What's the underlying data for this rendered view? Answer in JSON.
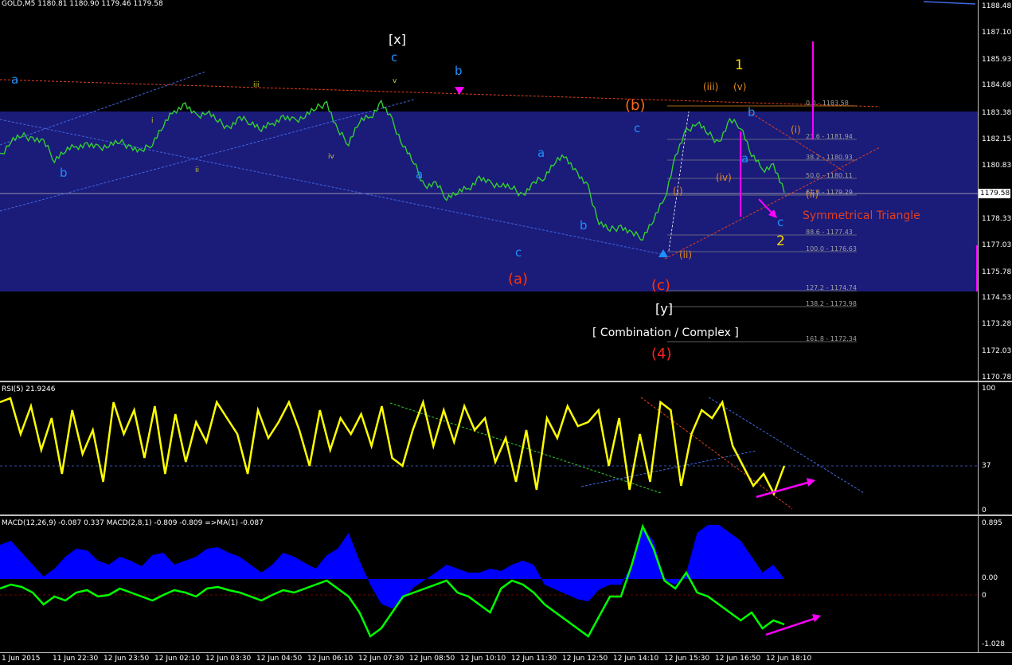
{
  "header": {
    "main": "GOLD,M5  1180.81 1180.90 1179.46 1179.58",
    "rsi": "RSI(5) 21.9246",
    "macd": "MACD(12,26,9) -0.087 0.337  MACD(2,8,1) -0.809 -0.809  =>MA(1) -0.087"
  },
  "price_axis": [
    "1188.48",
    "1187.10",
    "1185.93",
    "1184.68",
    "1183.38",
    "1182.15",
    "1180.83",
    "1179.58",
    "1178.33",
    "1177.03",
    "1175.78",
    "1174.53",
    "1173.28",
    "1172.03",
    "1170.78"
  ],
  "current_price": "1179.58",
  "rsi_axis": [
    "100",
    "37",
    "0"
  ],
  "macd_axis": [
    "0.895",
    "0.00",
    "0",
    "-1.028"
  ],
  "time_axis": [
    "1 Jun 2015",
    "11 Jun 22:30",
    "12 Jun 23:50",
    "12 Jun 02:10",
    "12 Jun 03:30",
    "12 Jun 04:50",
    "12 Jun 06:10",
    "12 Jun 07:30",
    "12 Jun 08:50",
    "12 Jun 10:10",
    "12 Jun 11:30",
    "12 Jun 12:50",
    "12 Jun 14:10",
    "12 Jun 15:30",
    "12 Jun 16:50",
    "12 Jun 18:10"
  ],
  "fib_levels": [
    "0.0 - 1183.58",
    "23.6 - 1181.94",
    "38.2 - 1180.93",
    "50.0 - 1180.11",
    "61.8 - 1179.29",
    "88.6 - 1177.43",
    "100.0 - 1176.63",
    "127.2 - 1174.74",
    "138.2 - 1173.98",
    "161.8 - 1172.34"
  ],
  "wave_labels": {
    "x": "[x]",
    "y": "[y]",
    "combo": "[ Combination / Complex ]",
    "four": "(4)",
    "a_paren": "(a)",
    "b_paren": "(b)",
    "c_paren": "(c)",
    "one": "1",
    "two": "2",
    "triangle": "Symmetrical Triangle",
    "iii_paren": "(iii)",
    "v_paren": "(v)",
    "iv_paren": "(iv)",
    "i_paren": "(i)",
    "ii_paren": "(ii)",
    "ii_paren2": "(ii)",
    "i_paren2": "(i)",
    "a1": "a",
    "b1": "b",
    "c1": "c",
    "a2": "a",
    "b2": "b",
    "c2": "c",
    "a3": "a",
    "b3": "b",
    "c3": "c",
    "a4": "a",
    "b4": "b",
    "c4": "c",
    "small_i": "i",
    "small_ii": "ii",
    "small_iii": "iii",
    "small_iv": "iv",
    "small_v": "v"
  },
  "colors": {
    "background": "#000000",
    "zone": "#1b1b7a",
    "price": "#32cd32",
    "rsi": "#ffff00",
    "macd_hist": "#0000ff",
    "macd_line": "#00ff00",
    "wave_cyan": "#1e90ff",
    "wave_red": "#ff3300",
    "wave_orange": "#e08a1e",
    "magenta": "#ff00ff"
  },
  "chart_data": {
    "type": "line",
    "title": "GOLD,M5",
    "ylim": [
      1170.78,
      1188.48
    ],
    "series": [
      {
        "name": "GOLD",
        "values": [
          1181.3,
          1182.1,
          1182.3,
          1182.2,
          1182.0,
          1181.2,
          1181.6,
          1181.8,
          1181.9,
          1181.7,
          1181.9,
          1182.0,
          1181.8,
          1181.5,
          1182.0,
          1182.8,
          1183.5,
          1183.8,
          1183.2,
          1183.5,
          1183.0,
          1182.7,
          1183.1,
          1183.0,
          1182.6,
          1182.9,
          1183.2,
          1183.0,
          1183.3,
          1183.6,
          1183.9,
          1182.5,
          1182.0,
          1183.0,
          1183.2,
          1183.9,
          1183.0,
          1181.9,
          1181.0,
          1179.9,
          1180.0,
          1179.4,
          1179.6,
          1179.8,
          1180.3,
          1180.0,
          1180.0,
          1179.8,
          1179.5,
          1180.0,
          1180.4,
          1181.1,
          1181.3,
          1180.5,
          1179.8,
          1178.2,
          1177.8,
          1178.0,
          1177.6,
          1177.5,
          1178.3,
          1179.3,
          1181.3,
          1182.5,
          1183.0,
          1182.4,
          1182.0,
          1183.0,
          1182.8,
          1181.4,
          1180.7,
          1180.9,
          1179.6
        ]
      }
    ]
  }
}
